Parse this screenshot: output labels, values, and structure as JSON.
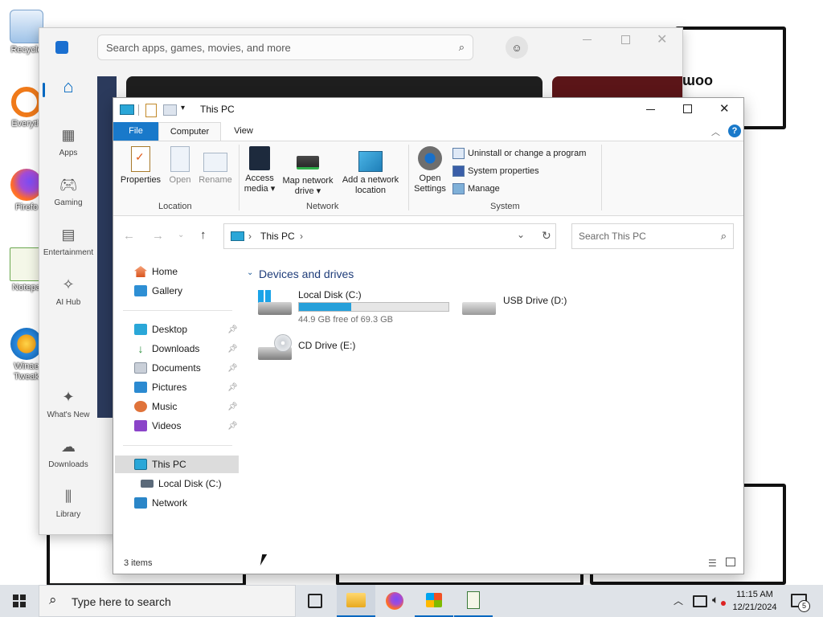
{
  "desktop": {
    "icons": [
      {
        "label": "Recycle",
        "icon": "recycle-bin-icon"
      },
      {
        "label": "Everyth",
        "icon": "everything-search-icon"
      },
      {
        "label": "Firefo",
        "icon": "firefox-icon"
      },
      {
        "label": "Notepa",
        "icon": "notepad-plus-icon"
      },
      {
        "label": "Winae Tweak",
        "icon": "winaero-tweaker-icon"
      }
    ]
  },
  "store": {
    "search_placeholder": "Search apps, games, movies, and more",
    "banner_text": "ɯoo",
    "rail": [
      {
        "label": "",
        "icon": "home-icon"
      },
      {
        "label": "Apps",
        "icon": "apps-icon"
      },
      {
        "label": "Gaming",
        "icon": "gaming-icon"
      },
      {
        "label": "Entertainment",
        "icon": "entertainment-icon"
      },
      {
        "label": "AI Hub",
        "icon": "ai-hub-icon"
      },
      {
        "label": "What's New",
        "icon": "whats-new-icon"
      },
      {
        "label": "Downloads",
        "icon": "downloads-icon"
      },
      {
        "label": "Library",
        "icon": "library-icon"
      }
    ]
  },
  "explorer": {
    "title": "This PC",
    "tabs": {
      "file": "File",
      "computer": "Computer",
      "view": "View"
    },
    "ribbon": {
      "properties": "Properties",
      "open": "Open",
      "rename": "Rename",
      "access_media_1": "Access",
      "access_media_2": "media ▾",
      "map_drive_1": "Map network",
      "map_drive_2": "drive ▾",
      "add_location_1": "Add a network",
      "add_location_2": "location",
      "open_settings_1": "Open",
      "open_settings_2": "Settings",
      "uninstall": "Uninstall or change a program",
      "system_properties": "System properties",
      "manage": "Manage",
      "group_location": "Location",
      "group_network": "Network",
      "group_system": "System"
    },
    "address": {
      "path": "This PC",
      "chevron": "›"
    },
    "search_placeholder": "Search This PC",
    "nav": {
      "home": "Home",
      "gallery": "Gallery",
      "desktop": "Desktop",
      "downloads": "Downloads",
      "documents": "Documents",
      "pictures": "Pictures",
      "music": "Music",
      "videos": "Videos",
      "this_pc": "This PC",
      "local_disk": "Local Disk (C:)",
      "network": "Network"
    },
    "section_title": "Devices and drives",
    "drives": [
      {
        "name": "Local Disk (C:)",
        "free_text": "44.9 GB free of 69.3 GB",
        "used_fraction": 0.352
      },
      {
        "name": "USB Drive (D:)"
      },
      {
        "name": "CD Drive (E:)"
      }
    ],
    "status": "3 items"
  },
  "taskbar": {
    "search_placeholder": "Type here to search",
    "time": "11:15 AM",
    "date": "12/21/2024",
    "notification_count": "5"
  },
  "colors": {
    "accent": "#0067c0",
    "file_tab": "#1979ca",
    "drive_fill": "#26a0da",
    "taskbar": "#dfe3e8"
  }
}
